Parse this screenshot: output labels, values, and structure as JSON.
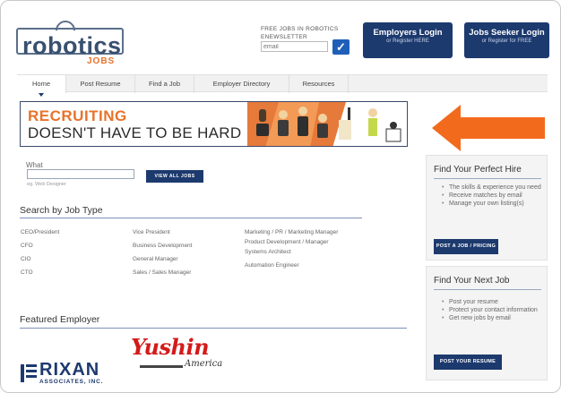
{
  "header": {
    "logo_text": "robotics",
    "logo_sub": "JOBS",
    "newsletter": {
      "line1": "FREE JOBS IN ROBOTICS",
      "line2": "ENEWSLETTER",
      "email_placeholder": "email"
    },
    "employers_button": {
      "title": "Employers Login",
      "sub": "or Register HERE"
    },
    "seeker_button": {
      "title": "Jobs Seeker Login",
      "sub": "or Register for FREE"
    }
  },
  "nav": {
    "items": [
      {
        "label": "Home"
      },
      {
        "label": "Post Resume"
      },
      {
        "label": "Find a Job"
      },
      {
        "label": "Employer Directory"
      },
      {
        "label": "Resources"
      }
    ]
  },
  "banner": {
    "line1": "RECRUITING",
    "line2": "DOESN'T HAVE TO BE HARD"
  },
  "search": {
    "what_label": "What",
    "what_hint": "eg. Web Designer",
    "button": "VIEW ALL JOBS"
  },
  "job_types": {
    "heading": "Search by Job Type",
    "col1": [
      "CEO/President",
      "CFO",
      "CIO",
      "CTO"
    ],
    "col2": [
      "Vice President",
      "Business Development",
      "General Manager",
      "Sales / Sales Manager"
    ],
    "col3": [
      "Marketing / PR / Marketing Manager",
      "Product Development / Manager",
      "Systems Architect",
      "Automation Engineer"
    ]
  },
  "featured": {
    "heading": "Featured Employer",
    "yushin": {
      "name": "Yushin",
      "sub": "America"
    },
    "rixan": {
      "name": "RIXAN",
      "sub": "ASSOCIATES, INC."
    }
  },
  "sidebar": {
    "hire": {
      "heading": "Find Your Perfect Hire",
      "items": [
        "The skills & experience you need",
        "Receive matches by email",
        "Manage your own listing(s)"
      ],
      "button": "POST A JOB / PRICING"
    },
    "nextjob": {
      "heading": "Find Your Next Job",
      "items": [
        "Post your resume",
        "Protect your contact information",
        "Get new jobs by email"
      ],
      "button": "POST YOUR RESUME"
    }
  },
  "colors": {
    "brand_navy": "#1d3a6e",
    "accent_orange": "#e8732a",
    "arrow_orange": "#f26b1d",
    "yushin_red": "#d41a1a"
  }
}
